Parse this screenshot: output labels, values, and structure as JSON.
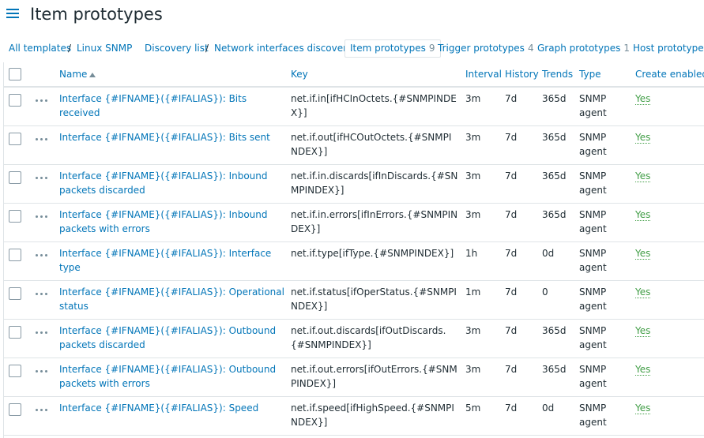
{
  "header": {
    "title": "Item prototypes"
  },
  "breadcrumbs": {
    "all_templates": "All templates",
    "sep1": "/",
    "template": "Linux SNMP",
    "discovery_list": "Discovery list",
    "sep2": "/",
    "discovery_rule": "Network interfaces discovery",
    "item_prototypes": "Item prototypes",
    "item_prototypes_count": "9",
    "trigger_prototypes": "Trigger prototypes",
    "trigger_prototypes_count": "4",
    "graph_prototypes": "Graph prototypes",
    "graph_prototypes_count": "1",
    "host_prototypes": "Host prototypes"
  },
  "table": {
    "columns": {
      "name": "Name",
      "key": "Key",
      "interval": "Interval",
      "history": "History",
      "trends": "Trends",
      "type": "Type",
      "create_enabled": "Create enabled"
    },
    "rows": [
      {
        "name": "Interface {#IFNAME}({#IFALIAS}): Bits received",
        "key": "net.if.in[ifHCInOctets.{#SNMPINDEX}]",
        "interval": "3m",
        "history": "7d",
        "trends": "365d",
        "type": "SNMP agent",
        "create_enabled": "Yes"
      },
      {
        "name": "Interface {#IFNAME}({#IFALIAS}): Bits sent",
        "key": "net.if.out[ifHCOutOctets.{#SNMPINDEX}]",
        "interval": "3m",
        "history": "7d",
        "trends": "365d",
        "type": "SNMP agent",
        "create_enabled": "Yes"
      },
      {
        "name": "Interface {#IFNAME}({#IFALIAS}): Inbound packets discarded",
        "key": "net.if.in.discards[ifInDiscards.{#SNMPINDEX}]",
        "interval": "3m",
        "history": "7d",
        "trends": "365d",
        "type": "SNMP agent",
        "create_enabled": "Yes"
      },
      {
        "name": "Interface {#IFNAME}({#IFALIAS}): Inbound packets with errors",
        "key": "net.if.in.errors[ifInErrors.{#SNMPINDEX}]",
        "interval": "3m",
        "history": "7d",
        "trends": "365d",
        "type": "SNMP agent",
        "create_enabled": "Yes"
      },
      {
        "name": "Interface {#IFNAME}({#IFALIAS}): Interface type",
        "key": "net.if.type[ifType.{#SNMPINDEX}]",
        "interval": "1h",
        "history": "7d",
        "trends": "0d",
        "type": "SNMP agent",
        "create_enabled": "Yes"
      },
      {
        "name": "Interface {#IFNAME}({#IFALIAS}): Operational status",
        "key": "net.if.status[ifOperStatus.{#SNMPINDEX}]",
        "interval": "1m",
        "history": "7d",
        "trends": "0",
        "type": "SNMP agent",
        "create_enabled": "Yes"
      },
      {
        "name": "Interface {#IFNAME}({#IFALIAS}): Outbound packets discarded",
        "key": "net.if.out.discards[ifOutDiscards.{#SNMPINDEX}]",
        "interval": "3m",
        "history": "7d",
        "trends": "365d",
        "type": "SNMP agent",
        "create_enabled": "Yes"
      },
      {
        "name": "Interface {#IFNAME}({#IFALIAS}): Outbound packets with errors",
        "key": "net.if.out.errors[ifOutErrors.{#SNMPINDEX}]",
        "interval": "3m",
        "history": "7d",
        "trends": "365d",
        "type": "SNMP agent",
        "create_enabled": "Yes"
      },
      {
        "name": "Interface {#IFNAME}({#IFALIAS}): Speed",
        "key": "net.if.speed[ifHighSpeed.{#SNMPINDEX}]",
        "interval": "5m",
        "history": "7d",
        "trends": "0d",
        "type": "SNMP agent",
        "create_enabled": "Yes"
      }
    ]
  },
  "colors": {
    "link": "#0275b8",
    "enabled": "#429e47",
    "border": "#dfe4e7",
    "text": "#1f2c33"
  }
}
